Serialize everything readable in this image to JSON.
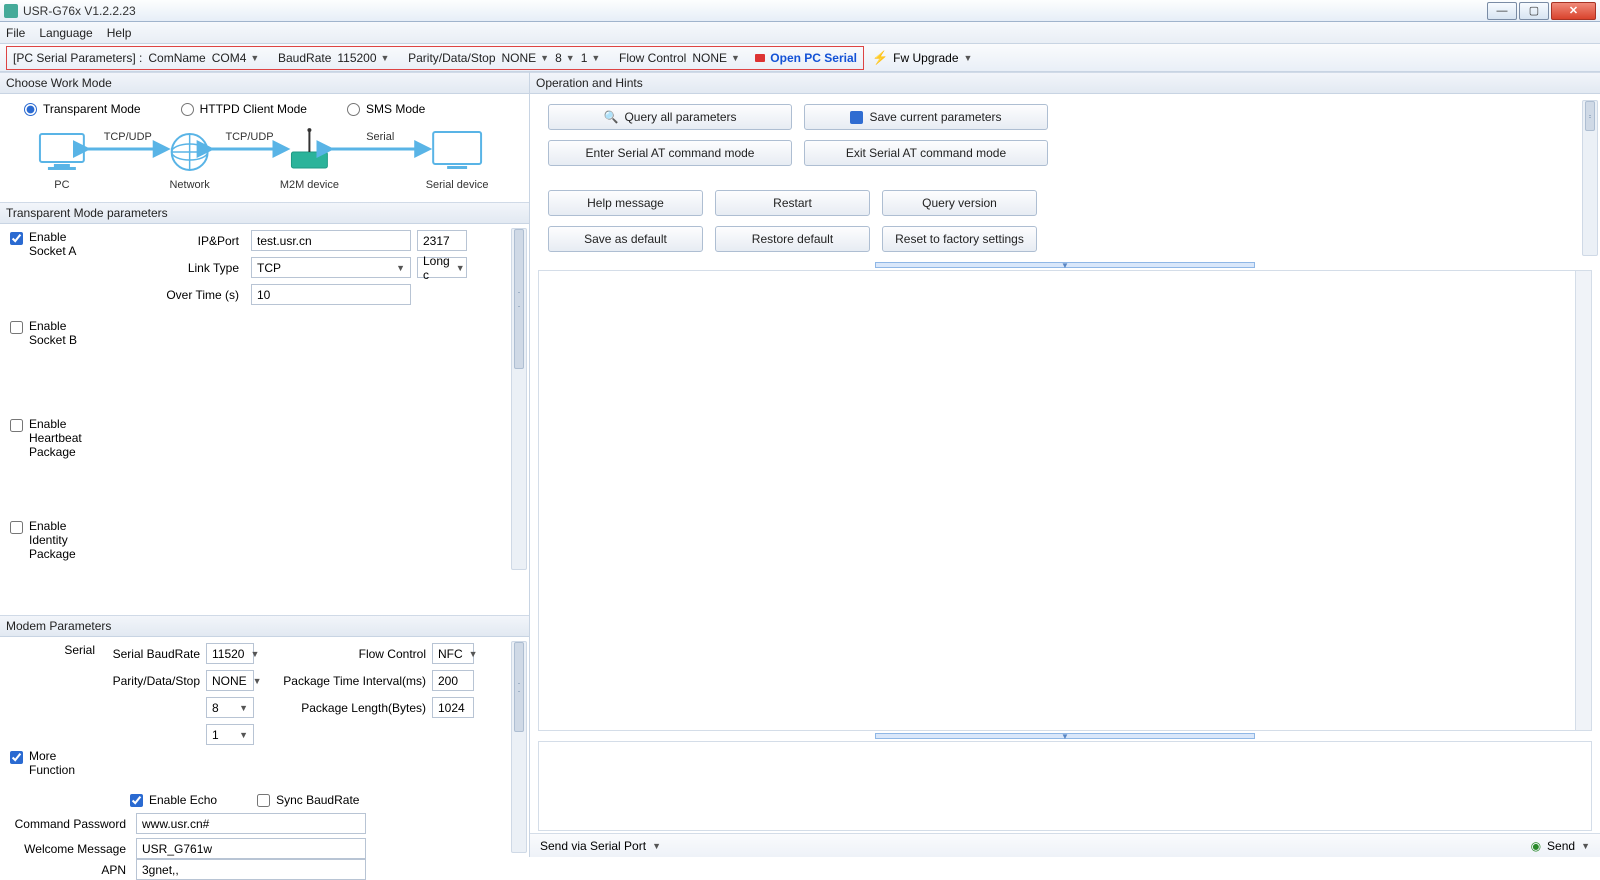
{
  "title": "USR-G76x V1.2.2.23",
  "menus": {
    "file": "File",
    "language": "Language",
    "help": "Help"
  },
  "toolbar": {
    "serial_label": "[PC Serial Parameters] :",
    "comname_label": "ComName",
    "comname": "COM4",
    "baud_label": "BaudRate",
    "baud": "115200",
    "parity_label": "Parity/Data/Stop",
    "parity": "NONE",
    "data": "8",
    "stop": "1",
    "flow_label": "Flow Control",
    "flow": "NONE",
    "open_serial": "Open PC Serial",
    "fw_upgrade": "Fw Upgrade"
  },
  "left": {
    "choose_work_mode": "Choose Work Mode",
    "modes": {
      "transparent": "Transparent Mode",
      "httpd": "HTTPD Client Mode",
      "sms": "SMS Mode"
    },
    "diagram": {
      "tcpudp1": "TCP/UDP",
      "tcpudp2": "TCP/UDP",
      "serial": "Serial",
      "pc": "PC",
      "network": "Network",
      "m2m": "M2M device",
      "serial_device": "Serial device"
    },
    "trans_header": "Transparent Mode parameters",
    "socketA": {
      "enable": "Enable",
      "sub": "Socket A",
      "ipport_label": "IP&Port",
      "ip": "test.usr.cn",
      "port": "2317",
      "linktype_label": "Link Type",
      "linktype": "TCP",
      "conn": "Long c",
      "overtime_label": "Over Time (s)",
      "overtime": "10"
    },
    "socketB": {
      "enable": "Enable",
      "sub": "Socket B"
    },
    "heartbeat": {
      "enable": "Enable",
      "l2": "Heartbeat",
      "l3": "Package"
    },
    "identity": {
      "enable": "Enable",
      "l2": "Identity",
      "l3": "Package"
    },
    "modem_header": "Modem Parameters",
    "serial_label": "Serial",
    "modem": {
      "serial_baud_label": "Serial BaudRate",
      "serial_baud": "11520",
      "flow_label": "Flow Control",
      "flow": "NFC",
      "parity_label": "Parity/Data/Stop",
      "parity": "NONE",
      "data": "8",
      "stop": "1",
      "pkg_time_label": "Package Time Interval(ms)",
      "pkg_time": "200",
      "pkg_len_label": "Package Length(Bytes)",
      "pkg_len": "1024"
    },
    "more_func": {
      "l1": "More",
      "l2": "Function"
    },
    "echo": "Enable Echo",
    "sync_baud": "Sync BaudRate",
    "cmd_pw_label": "Command Password",
    "cmd_pw": "www.usr.cn#",
    "welcome_label": "Welcome Message",
    "welcome": "USR_G761w",
    "apn_label": "APN",
    "apn": "3gnet,,"
  },
  "right": {
    "ops_header": "Operation and Hints",
    "query_all": "Query all parameters",
    "save_current": "Save current parameters",
    "enter_at": "Enter Serial AT command mode",
    "exit_at": "Exit Serial AT command mode",
    "help": "Help message",
    "restart": "Restart",
    "query_ver": "Query version",
    "save_default": "Save as default",
    "restore_default": "Restore default",
    "factory": "Reset to factory settings",
    "send_via": "Send via Serial Port",
    "send": "Send"
  }
}
